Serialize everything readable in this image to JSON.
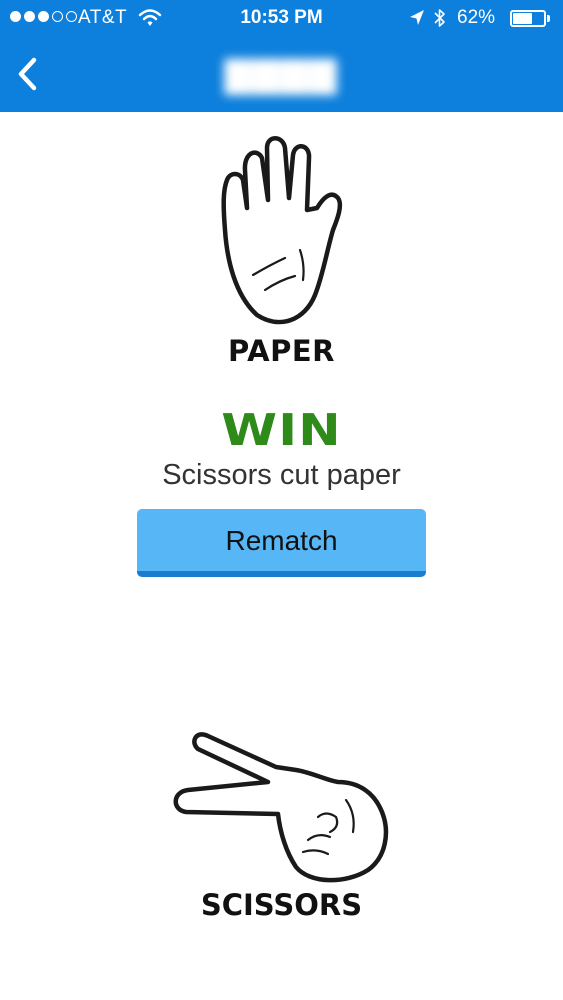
{
  "status_bar": {
    "signal_bars": 3,
    "signal_total": 5,
    "carrier": "AT&T",
    "time": "10:53 PM",
    "battery_percent_label": "62%",
    "battery_level": 0.62,
    "icons": [
      "wifi-icon",
      "location-arrow-icon",
      "bluetooth-icon",
      "battery-icon"
    ]
  },
  "nav": {
    "title": "(blurred)",
    "back_icon": "chevron-left-icon"
  },
  "game": {
    "opponent_choice": "PAPER",
    "result": "WIN",
    "message": "Scissors cut paper",
    "rematch_label": "Rematch",
    "player_choice": "SCISSORS"
  },
  "colors": {
    "header": "#0d7fdc",
    "win": "#2e8b1a",
    "button": "#57b6f6",
    "button_shadow": "#1a7ecf"
  }
}
